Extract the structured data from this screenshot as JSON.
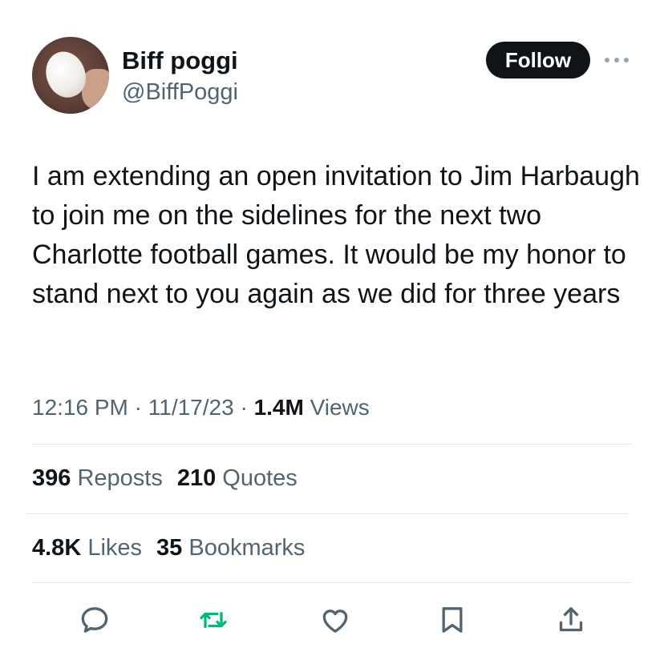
{
  "author": {
    "display_name": "Biff poggi",
    "handle": "@BiffPoggi"
  },
  "follow_label": "Follow",
  "tweet": {
    "text": "I am extending an open invitation to Jim Harbaugh to join me on the sidelines for the next two Charlotte football games. It would be my honor to stand next to you again as we did for three years"
  },
  "meta": {
    "time": "12:16 PM",
    "separator": " · ",
    "date": "11/17/23",
    "views_count": "1.4M",
    "views_label": " Views"
  },
  "stats": {
    "reposts_count": "396",
    "reposts_label": " Reposts",
    "quotes_count": "210",
    "quotes_label": " Quotes",
    "likes_count": "4.8K",
    "likes_label": " Likes",
    "bookmarks_count": "35",
    "bookmarks_label": " Bookmarks"
  },
  "actions": {
    "icons": [
      "reply-icon",
      "repost-icon",
      "like-icon",
      "bookmark-icon",
      "share-icon"
    ],
    "icon_color": "#536471",
    "repost_color": "#00ba7c"
  }
}
